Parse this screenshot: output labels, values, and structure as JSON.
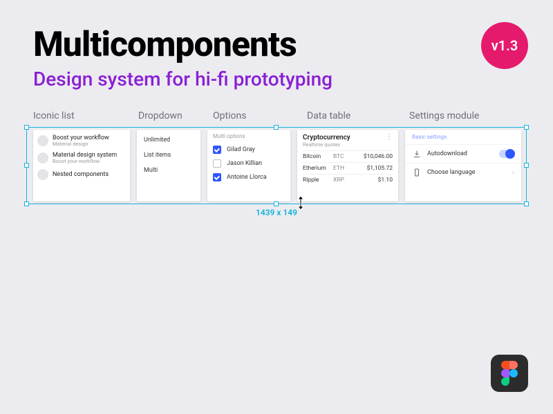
{
  "title": "Multicomponents",
  "subtitle": "Design system for hi-fi prototyping",
  "version": "v1.3",
  "selection_dimensions": "1439 x 149",
  "sections": {
    "iconic_list": "Iconic list",
    "dropdown": "Dropdown",
    "options": "Options",
    "data_table": "Data table",
    "settings_module": "Settings module"
  },
  "iconic_list": {
    "items": [
      {
        "title": "Boost your workflow",
        "subtitle": "Material design"
      },
      {
        "title": "Material design system",
        "subtitle": "Boost your workflow"
      },
      {
        "title": "Nested components",
        "subtitle": ""
      }
    ]
  },
  "dropdown": {
    "items": [
      "Unlimited",
      "List items",
      "Multi"
    ]
  },
  "options": {
    "header": "Multi options",
    "items": [
      {
        "label": "Gilad Gray",
        "checked": true
      },
      {
        "label": "Jason Killian",
        "checked": false
      },
      {
        "label": "Antoine Llorca",
        "checked": true
      }
    ]
  },
  "data_table": {
    "title": "Cryptocurrency",
    "subtitle": "Realtime quotes",
    "rows": [
      {
        "name": "Bitcoin",
        "symbol": "BTC",
        "price": "$10,046.00"
      },
      {
        "name": "Etherium",
        "symbol": "ETH",
        "price": "$1,105.72"
      },
      {
        "name": "Ripple",
        "symbol": "XRP",
        "price": "$1.10"
      }
    ]
  },
  "settings": {
    "header": "Basic settings",
    "items": [
      {
        "icon": "download-icon",
        "label": "Autodownload",
        "control": "toggle"
      },
      {
        "icon": "phone-icon",
        "label": "Choose language",
        "control": "chevron"
      }
    ]
  }
}
